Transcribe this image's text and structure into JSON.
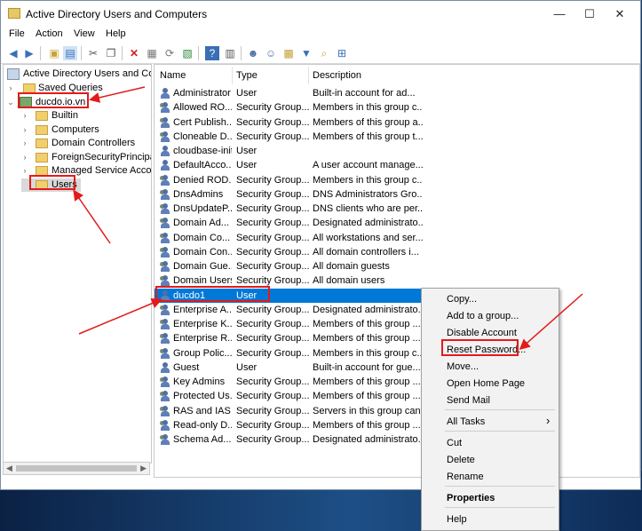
{
  "window": {
    "title": "Active Directory Users and Computers",
    "controls": [
      "—",
      "☐",
      "✕"
    ]
  },
  "menu": [
    "File",
    "Action",
    "View",
    "Help"
  ],
  "tree": {
    "root": "Active Directory Users and Com",
    "saved_queries": "Saved Queries",
    "domain": "ducdo.io.vn",
    "children": [
      "Builtin",
      "Computers",
      "Domain Controllers",
      "ForeignSecurityPrincipals",
      "Managed Service Accour",
      "Users"
    ]
  },
  "list": {
    "columns": [
      "Name",
      "Type",
      "Description"
    ],
    "rows": [
      {
        "name": "Administrator",
        "type": "User",
        "desc": "Built-in account for ad...",
        "kind": "user"
      },
      {
        "name": "Allowed RO...",
        "type": "Security Group...",
        "desc": "Members in this group c...",
        "kind": "group"
      },
      {
        "name": "Cert Publish...",
        "type": "Security Group...",
        "desc": "Members of this group a...",
        "kind": "group"
      },
      {
        "name": "Cloneable D...",
        "type": "Security Group...",
        "desc": "Members of this group t...",
        "kind": "group"
      },
      {
        "name": "cloudbase-init",
        "type": "User",
        "desc": "",
        "kind": "user"
      },
      {
        "name": "DefaultAcco...",
        "type": "User",
        "desc": "A user account manage...",
        "kind": "user"
      },
      {
        "name": "Denied ROD...",
        "type": "Security Group...",
        "desc": "Members in this group c...",
        "kind": "group"
      },
      {
        "name": "DnsAdmins",
        "type": "Security Group...",
        "desc": "DNS Administrators Gro...",
        "kind": "group"
      },
      {
        "name": "DnsUpdateP...",
        "type": "Security Group...",
        "desc": "DNS clients who are per...",
        "kind": "group"
      },
      {
        "name": "Domain Ad...",
        "type": "Security Group...",
        "desc": "Designated administrato...",
        "kind": "group"
      },
      {
        "name": "Domain Co...",
        "type": "Security Group...",
        "desc": "All workstations and ser...",
        "kind": "group"
      },
      {
        "name": "Domain Con...",
        "type": "Security Group...",
        "desc": "All domain controllers i...",
        "kind": "group"
      },
      {
        "name": "Domain Gue...",
        "type": "Security Group...",
        "desc": "All domain guests",
        "kind": "group"
      },
      {
        "name": "Domain Users",
        "type": "Security Group...",
        "desc": "All domain users",
        "kind": "group"
      },
      {
        "name": "ducdo1",
        "type": "User",
        "desc": "",
        "kind": "user",
        "selected": true
      },
      {
        "name": "Enterprise A...",
        "type": "Security Group...",
        "desc": "Designated administrato...",
        "kind": "group"
      },
      {
        "name": "Enterprise K...",
        "type": "Security Group...",
        "desc": "Members of this group ...",
        "kind": "group"
      },
      {
        "name": "Enterprise R...",
        "type": "Security Group...",
        "desc": "Members of this group ...",
        "kind": "group"
      },
      {
        "name": "Group Polic...",
        "type": "Security Group...",
        "desc": "Members in this group c...",
        "kind": "group"
      },
      {
        "name": "Guest",
        "type": "User",
        "desc": "Built-in account for gue...",
        "kind": "user"
      },
      {
        "name": "Key Admins",
        "type": "Security Group...",
        "desc": "Members of this group ...",
        "kind": "group"
      },
      {
        "name": "Protected Us...",
        "type": "Security Group...",
        "desc": "Members of this group ...",
        "kind": "group"
      },
      {
        "name": "RAS and IAS ...",
        "type": "Security Group...",
        "desc": "Servers in this group can...",
        "kind": "group"
      },
      {
        "name": "Read-only D...",
        "type": "Security Group...",
        "desc": "Members of this group ...",
        "kind": "group"
      },
      {
        "name": "Schema Ad...",
        "type": "Security Group...",
        "desc": "Designated administrato...",
        "kind": "group"
      }
    ]
  },
  "context_menu": {
    "items": [
      "Copy...",
      "Add to a group...",
      "Disable Account",
      "Reset Password...",
      "Move...",
      "Open Home Page",
      "Send Mail",
      "All Tasks",
      "Cut",
      "Delete",
      "Rename",
      "Properties",
      "Help"
    ],
    "submenu_arrow": "›"
  },
  "colors": {
    "selection": "#0078d7",
    "annotation": "#e21b1b"
  }
}
